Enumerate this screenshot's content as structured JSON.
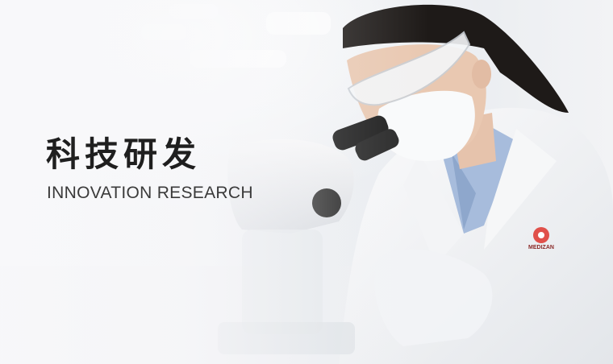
{
  "banner": {
    "title": "科技研发",
    "subtitle": "INNOVATION RESEARCH"
  },
  "photo": {
    "subject": "scientist-at-microscope",
    "palette": {
      "background": "#eef0f3",
      "coat": "#f7f8fa",
      "hair": "#1e1a18",
      "skin": "#e8c7b0",
      "shirt": "#9db4d6",
      "microscope": "#1c1c1c"
    }
  }
}
